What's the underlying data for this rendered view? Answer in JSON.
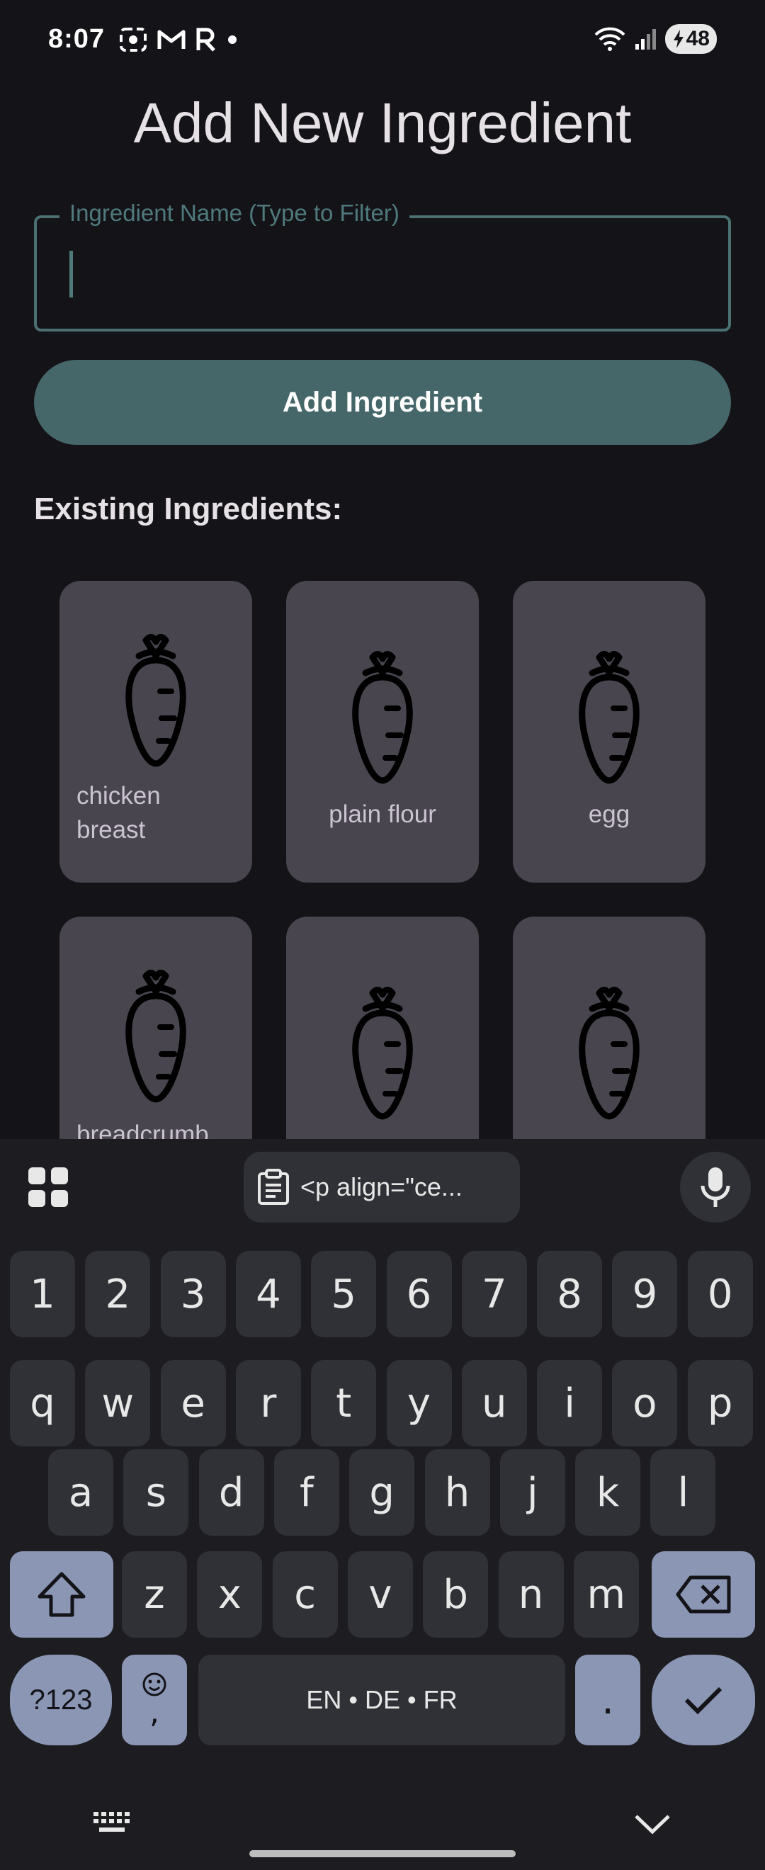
{
  "status_bar": {
    "time": "8:07",
    "battery": "48",
    "icons": [
      "screenshot-icon",
      "gmail-icon",
      "r-app-icon",
      "dot-icon",
      "wifi-icon",
      "signal-icon",
      "battery-charging-icon"
    ]
  },
  "page": {
    "title": "Add New Ingredient",
    "field_label": "Ingredient Name (Type to Filter)",
    "field_value": "",
    "add_button": "Add Ingredient",
    "section_heading": "Existing Ingredients:"
  },
  "ingredients": [
    {
      "label_line1": "chicken",
      "label_line2": "breast",
      "icon": "carrot-icon"
    },
    {
      "label_line1": "plain flour",
      "label_line2": "",
      "icon": "carrot-icon"
    },
    {
      "label_line1": "egg",
      "label_line2": "",
      "icon": "carrot-icon"
    },
    {
      "label_line1": "breadcrumb",
      "label_line2": "",
      "icon": "carrot-icon"
    },
    {
      "label_line1": "",
      "label_line2": "",
      "icon": "carrot-icon"
    },
    {
      "label_line1": "",
      "label_line2": "",
      "icon": "carrot-icon"
    }
  ],
  "keyboard": {
    "clipboard_text": "<p align=\"ce...",
    "row_numbers": [
      "1",
      "2",
      "3",
      "4",
      "5",
      "6",
      "7",
      "8",
      "9",
      "0"
    ],
    "row1": [
      "q",
      "w",
      "e",
      "r",
      "t",
      "y",
      "u",
      "i",
      "o",
      "p"
    ],
    "row2": [
      "a",
      "s",
      "d",
      "f",
      "g",
      "h",
      "j",
      "k",
      "l"
    ],
    "row3": [
      "z",
      "x",
      "c",
      "v",
      "b",
      "n",
      "m"
    ],
    "symbols_key": "?123",
    "comma_key": ",",
    "space_label": "EN • DE • FR",
    "period_key": "."
  },
  "colors": {
    "background": "#141318",
    "accent": "#456769",
    "card": "#49454f",
    "key": "#2f3136",
    "key_modifier": "#8a96b4"
  }
}
